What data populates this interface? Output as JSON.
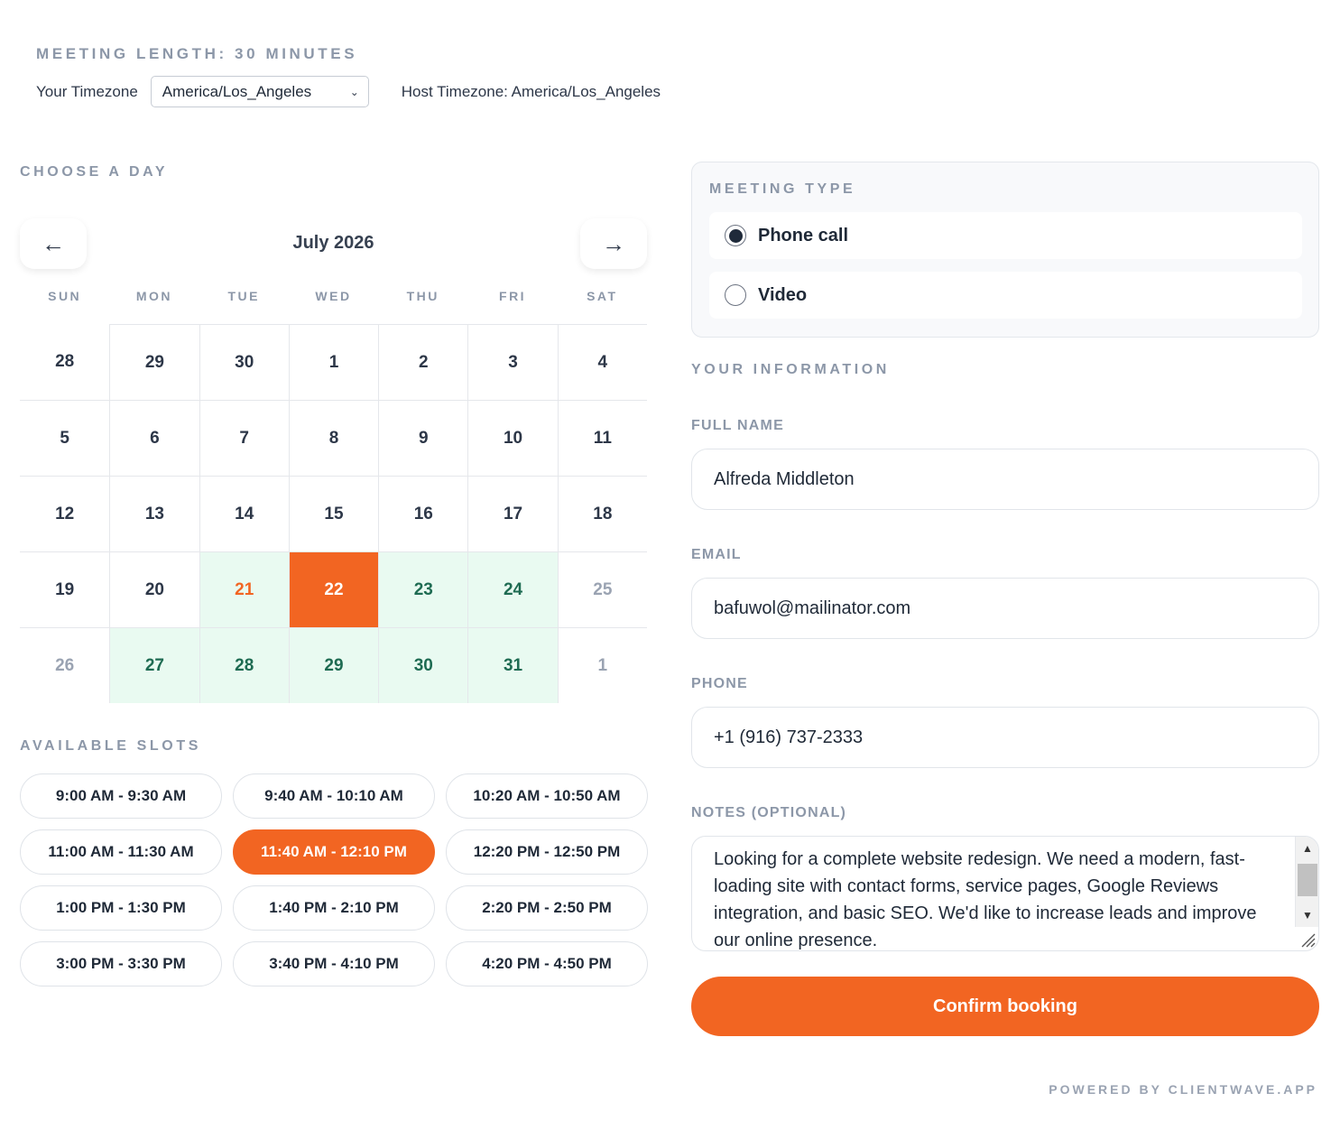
{
  "header": {
    "meeting_length": "MEETING LENGTH: 30 MINUTES",
    "your_timezone_label": "Your Timezone",
    "your_timezone_value": "America/Los_Angeles",
    "host_timezone": "Host Timezone: America/Los_Angeles"
  },
  "calendar": {
    "section_label": "CHOOSE A DAY",
    "month": "July 2026",
    "prev_icon": "arrow-left-icon",
    "next_icon": "arrow-right-icon",
    "prev_glyph": "←",
    "next_glyph": "→",
    "weekdays": [
      "SUN",
      "MON",
      "TUE",
      "WED",
      "THU",
      "FRI",
      "SAT"
    ],
    "days": [
      {
        "label": "28",
        "state": "normal"
      },
      {
        "label": "29",
        "state": "normal"
      },
      {
        "label": "30",
        "state": "normal"
      },
      {
        "label": "1",
        "state": "normal"
      },
      {
        "label": "2",
        "state": "normal"
      },
      {
        "label": "3",
        "state": "normal"
      },
      {
        "label": "4",
        "state": "normal"
      },
      {
        "label": "5",
        "state": "normal"
      },
      {
        "label": "6",
        "state": "normal"
      },
      {
        "label": "7",
        "state": "normal"
      },
      {
        "label": "8",
        "state": "normal"
      },
      {
        "label": "9",
        "state": "normal"
      },
      {
        "label": "10",
        "state": "normal"
      },
      {
        "label": "11",
        "state": "normal"
      },
      {
        "label": "12",
        "state": "normal"
      },
      {
        "label": "13",
        "state": "normal"
      },
      {
        "label": "14",
        "state": "normal"
      },
      {
        "label": "15",
        "state": "normal"
      },
      {
        "label": "16",
        "state": "normal"
      },
      {
        "label": "17",
        "state": "normal"
      },
      {
        "label": "18",
        "state": "normal"
      },
      {
        "label": "19",
        "state": "normal"
      },
      {
        "label": "20",
        "state": "normal"
      },
      {
        "label": "21",
        "state": "today"
      },
      {
        "label": "22",
        "state": "selected"
      },
      {
        "label": "23",
        "state": "avail"
      },
      {
        "label": "24",
        "state": "avail"
      },
      {
        "label": "25",
        "state": "muted"
      },
      {
        "label": "26",
        "state": "muted"
      },
      {
        "label": "27",
        "state": "avail"
      },
      {
        "label": "28",
        "state": "avail"
      },
      {
        "label": "29",
        "state": "avail"
      },
      {
        "label": "30",
        "state": "avail"
      },
      {
        "label": "31",
        "state": "avail"
      },
      {
        "label": "1",
        "state": "muted"
      }
    ]
  },
  "slots": {
    "section_label": "AVAILABLE SLOTS",
    "items": [
      {
        "label": "9:00 AM - 9:30 AM",
        "selected": false
      },
      {
        "label": "9:40 AM - 10:10 AM",
        "selected": false
      },
      {
        "label": "10:20 AM - 10:50 AM",
        "selected": false
      },
      {
        "label": "11:00 AM - 11:30 AM",
        "selected": false
      },
      {
        "label": "11:40 AM - 12:10 PM",
        "selected": true
      },
      {
        "label": "12:20 PM - 12:50 PM",
        "selected": false
      },
      {
        "label": "1:00 PM - 1:30 PM",
        "selected": false
      },
      {
        "label": "1:40 PM - 2:10 PM",
        "selected": false
      },
      {
        "label": "2:20 PM - 2:50 PM",
        "selected": false
      },
      {
        "label": "3:00 PM - 3:30 PM",
        "selected": false
      },
      {
        "label": "3:40 PM - 4:10 PM",
        "selected": false
      },
      {
        "label": "4:20 PM - 4:50 PM",
        "selected": false
      }
    ]
  },
  "meeting_type": {
    "section_label": "MEETING TYPE",
    "options": [
      {
        "label": "Phone call",
        "checked": true
      },
      {
        "label": "Video",
        "checked": false
      }
    ]
  },
  "form": {
    "section_label": "YOUR INFORMATION",
    "full_name_label": "FULL NAME",
    "full_name_value": "Alfreda Middleton",
    "email_label": "EMAIL",
    "email_value": "bafuwol@mailinator.com",
    "phone_label": "PHONE",
    "phone_value": "+1 (916) 737-2333",
    "notes_label": "NOTES (OPTIONAL)",
    "notes_value": "Looking for a complete website redesign. We need a modern, fast-loading site with contact forms, service pages, Google Reviews integration, and basic SEO. We'd like to increase leads and improve our online presence.",
    "confirm_label": "Confirm booking"
  },
  "footer": {
    "powered_by": "POWERED BY CLIENTWAVE.APP"
  },
  "colors": {
    "accent": "#f26522",
    "available_bg": "#e9faf1",
    "available_text": "#1e6b52",
    "muted_text": "#8c97a8"
  }
}
